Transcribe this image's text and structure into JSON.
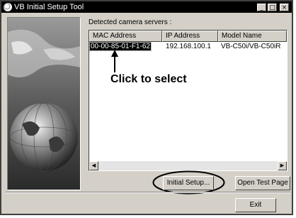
{
  "window": {
    "title": "VB Initial Setup Tool",
    "minimize": "_",
    "maximize": "□",
    "close": "×"
  },
  "detected_label": "Detected camera servers :",
  "list": {
    "columns": [
      "MAC Address",
      "IP Address",
      "Model Name"
    ],
    "rows": [
      {
        "mac": "00-00-85-01-F1-62",
        "ip": "192.168.100.1",
        "model": "VB-C50i/VB-C50iR"
      }
    ]
  },
  "annotation": "Click to select",
  "buttons": {
    "initial_setup": "Initial Setup...",
    "open_test_page": "Open Test Page",
    "exit": "Exit"
  }
}
